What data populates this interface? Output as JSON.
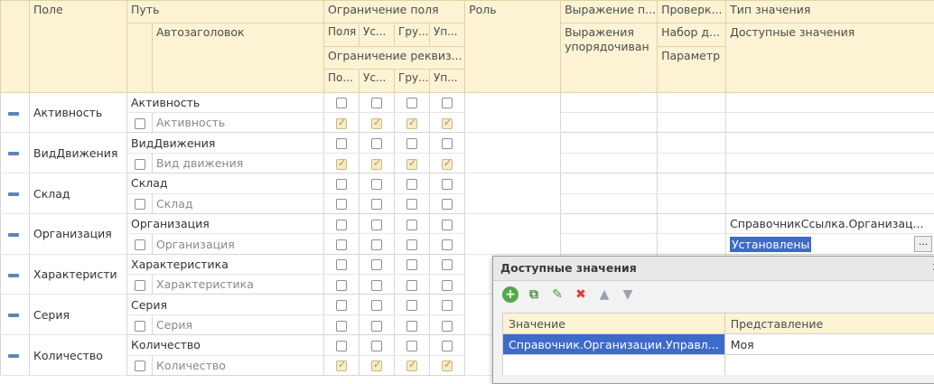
{
  "columns": {
    "pole": "Поле",
    "put": "Путь",
    "avtozagolovok": "Автозаголовок",
    "ogranichenie_polya": "Ограничение поля",
    "ogranichenie_rekviz": "Ограничение реквиз...",
    "sub": [
      "Поля",
      "Ус...",
      "Гру...",
      "Уп..."
    ],
    "sub2": [
      "По...",
      "Ус...",
      "Гру...",
      "Уп..."
    ],
    "rol": "Роль",
    "vyrazhenie": "Выражение п...",
    "vyrazhenie_uporyad": "Выражения упорядочиван",
    "proverka": "Проверк...",
    "nabor": "Набор д...",
    "parametr": "Параметр",
    "tip_znacheniya": "Тип значения",
    "dostupnye": "Доступные значения"
  },
  "rows": [
    {
      "field": "Активность",
      "path": "Активность",
      "title": "Активность",
      "c1": [
        false,
        false,
        false,
        false
      ],
      "c2": [
        true,
        true,
        true,
        true
      ],
      "type": "",
      "avail": ""
    },
    {
      "field": "ВидДвижения",
      "path": "ВидДвижения",
      "title": "Вид движения",
      "c1": [
        false,
        false,
        false,
        false
      ],
      "c2": [
        true,
        true,
        true,
        true
      ],
      "type": "",
      "avail": ""
    },
    {
      "field": "Склад",
      "path": "Склад",
      "title": "Склад",
      "c1": [
        false,
        false,
        false,
        false
      ],
      "c2": [
        false,
        false,
        false,
        false
      ],
      "type": "",
      "avail": ""
    },
    {
      "field": "Организация",
      "path": "Организация",
      "title": "Организация",
      "c1": [
        false,
        false,
        false,
        false
      ],
      "c2": [
        false,
        false,
        false,
        false
      ],
      "type": "СправочникСсылка.Организац...",
      "avail": "Установлены"
    },
    {
      "field": "Характеристи",
      "path": "Характеристика",
      "title": "Характеристика",
      "c1": [
        false,
        false,
        false,
        false
      ],
      "c2": [
        false,
        false,
        false,
        false
      ],
      "type": "",
      "avail": ""
    },
    {
      "field": "Серия",
      "path": "Серия",
      "title": "Серия",
      "c1": [
        false,
        false,
        false,
        false
      ],
      "c2": [
        false,
        false,
        false,
        false
      ],
      "type": "",
      "avail": ""
    },
    {
      "field": "Количество",
      "path": "Количество",
      "title": "Количество",
      "c1": [
        false,
        false,
        false,
        false
      ],
      "c2": [
        true,
        true,
        true,
        true
      ],
      "type": "",
      "avail": ""
    }
  ],
  "popup": {
    "title": "Доступные значения",
    "col_value": "Значение",
    "col_repr": "Представление",
    "value": "Справочник.Организации.Управл...",
    "repr": "Моя",
    "ellipsis": "..."
  }
}
